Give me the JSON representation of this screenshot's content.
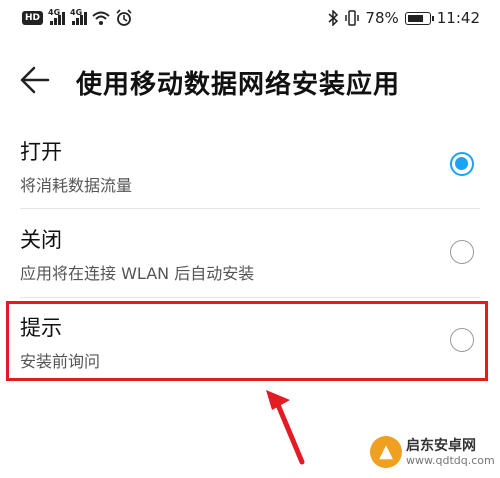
{
  "status_bar": {
    "hd": "HD",
    "signal1_tag": "4G",
    "signal2_tag": "4G",
    "battery_percent": "78%",
    "battery_level": 0.78,
    "time": "11:42"
  },
  "header": {
    "title": "使用移动数据网络安装应用"
  },
  "options": [
    {
      "title": "打开",
      "desc": "将消耗数据流量",
      "checked": true
    },
    {
      "title": "关闭",
      "desc": "应用将在连接 WLAN 后自动安装",
      "checked": false
    },
    {
      "title": "提示",
      "desc": "安装前询问",
      "checked": false
    }
  ],
  "annotation": {
    "highlight_color": "#e21b25"
  },
  "watermark": {
    "name": "启东安卓网",
    "url": "www.qdtdq.com"
  },
  "colors": {
    "accent": "#1aa3f2"
  }
}
